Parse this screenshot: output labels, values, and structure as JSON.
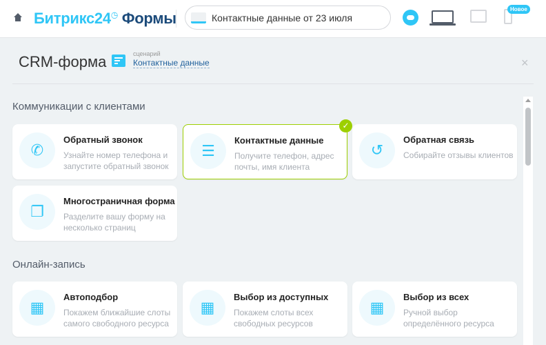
{
  "header": {
    "logo_brand": "Битрикс24",
    "logo_product": "Формы",
    "logo_clock": "◷",
    "search_value": "Контактные данные от 23 июля",
    "new_badge": "Новое"
  },
  "page": {
    "title": "CRM-форма",
    "scenario_label": "сценарий",
    "scenario_value": "Контактные данные",
    "close": "×"
  },
  "sections": [
    {
      "title": "Коммуникации с клиентами",
      "cards": [
        {
          "title": "Обратный звонок",
          "desc": "Узнайте номер телефона и запустите обратный звонок",
          "icon": "✆"
        },
        {
          "title": "Контактные данные",
          "desc": "Получите телефон, адрес почты, имя клиента",
          "icon": "☰",
          "check": "✓"
        },
        {
          "title": "Обратная связь",
          "desc": "Собирайте отзывы клиентов",
          "icon": "↺"
        },
        {
          "title": "Многостраничная форма",
          "desc": "Разделите вашу форму на несколько страниц",
          "icon": "❐"
        }
      ]
    },
    {
      "title": "Онлайн-запись",
      "cards": [
        {
          "title": "Автоподбор",
          "desc": "Покажем ближайшие слоты самого свободного ресурса",
          "icon": "▦"
        },
        {
          "title": "Выбор из доступных",
          "desc": "Покажем слоты всех свободных ресурсов",
          "icon": "▦"
        },
        {
          "title": "Выбор из всех",
          "desc": "Ручной выбор определённого ресурса",
          "icon": "▦"
        }
      ]
    }
  ],
  "colors": {
    "accent": "#2fc6f6",
    "selected": "#9dcf00"
  }
}
